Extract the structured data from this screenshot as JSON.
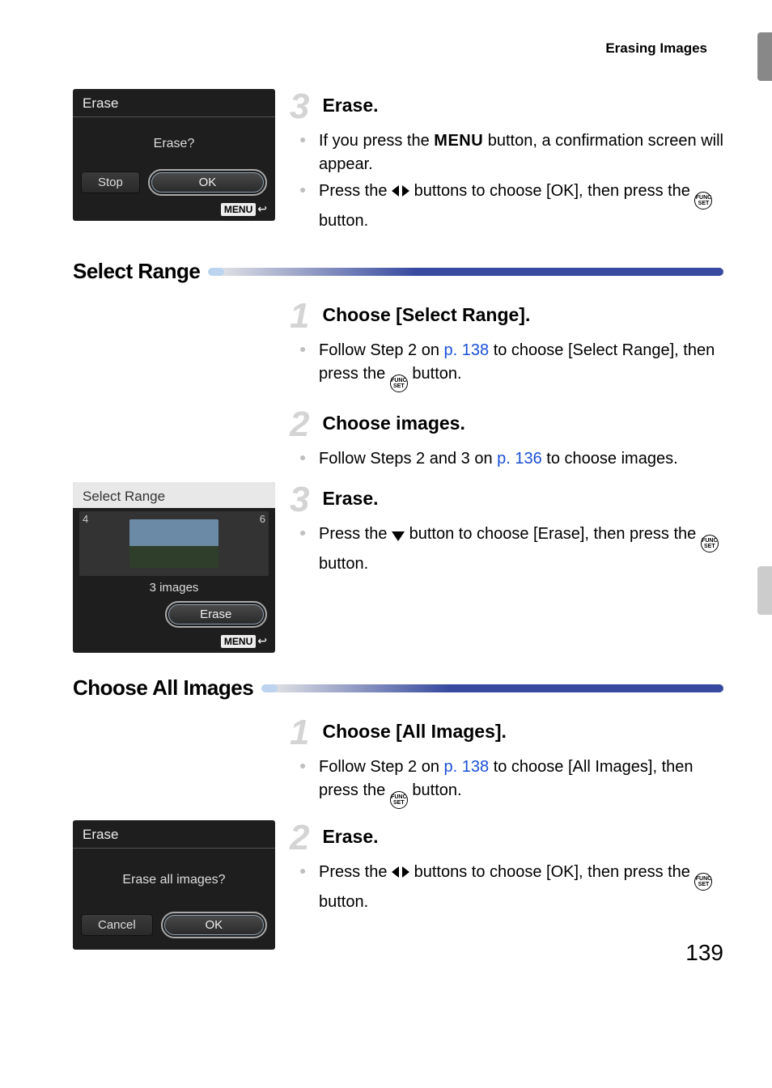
{
  "header": {
    "section": "Erasing Images"
  },
  "page_number": "139",
  "lcd1": {
    "title": "Erase",
    "prompt": "Erase?",
    "stop": "Stop",
    "ok": "OK",
    "menu": "MENU"
  },
  "lcd2": {
    "title": "Select Range",
    "count_left": "4",
    "count_right": "6",
    "caption": "3 images",
    "erase": "Erase",
    "menu": "MENU"
  },
  "lcd3": {
    "title": "Erase",
    "prompt": "Erase all images?",
    "cancel": "Cancel",
    "ok": "OK"
  },
  "step3a": {
    "num": "3",
    "title": "Erase.",
    "b1a": "If you press the ",
    "b1_menu": "MENU",
    "b1b": " button, a confirmation screen will appear.",
    "b2a": "Press the ",
    "b2b": " buttons to choose [OK], then press the ",
    "b2c": " button."
  },
  "sec_select_range": "Select Range",
  "sr_s1": {
    "num": "1",
    "title": "Choose [Select Range].",
    "b1a": "Follow Step 2 on ",
    "b1_link": "p. 138",
    "b1b": " to choose [Select Range], then press the ",
    "b1c": " button."
  },
  "sr_s2": {
    "num": "2",
    "title": "Choose images.",
    "b1a": "Follow Steps 2 and 3 on ",
    "b1_link": "p. 136",
    "b1b": " to choose images."
  },
  "sr_s3": {
    "num": "3",
    "title": "Erase.",
    "b1a": "Press the ",
    "b1b": " button to choose [Erase], then press the ",
    "b1c": " button."
  },
  "sec_all_images": "Choose All Images",
  "ai_s1": {
    "num": "1",
    "title": "Choose [All Images].",
    "b1a": "Follow Step 2 on ",
    "b1_link": "p. 138",
    "b1b": " to choose [All Images], then press the ",
    "b1c": " button."
  },
  "ai_s2": {
    "num": "2",
    "title": "Erase.",
    "b1a": "Press the ",
    "b1b": " buttons to choose [OK], then press the ",
    "b1c": " button."
  },
  "icons": {
    "funcset_top": "FUNC",
    "funcset_bot": "SET"
  }
}
